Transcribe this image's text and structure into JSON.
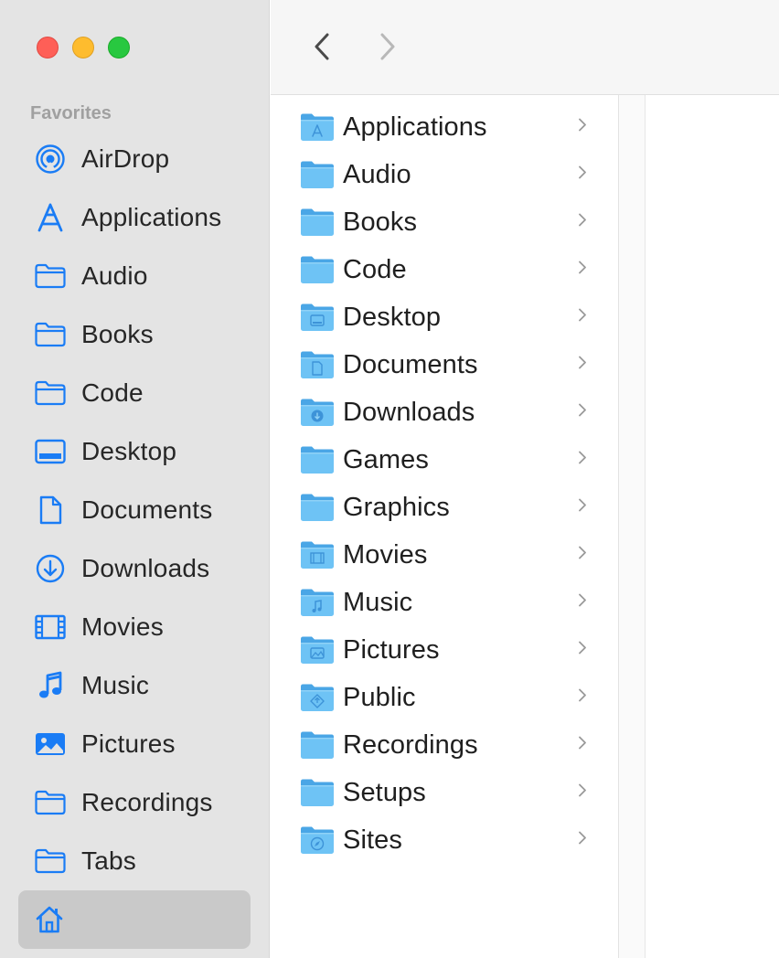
{
  "sidebar": {
    "heading": "Favorites",
    "items": [
      {
        "label": "AirDrop",
        "icon": "airdrop-icon"
      },
      {
        "label": "Applications",
        "icon": "applications-icon"
      },
      {
        "label": "Audio",
        "icon": "folder-icon"
      },
      {
        "label": "Books",
        "icon": "folder-icon"
      },
      {
        "label": "Code",
        "icon": "folder-icon"
      },
      {
        "label": "Desktop",
        "icon": "desktop-icon"
      },
      {
        "label": "Documents",
        "icon": "document-icon"
      },
      {
        "label": "Downloads",
        "icon": "download-icon"
      },
      {
        "label": "Movies",
        "icon": "film-icon"
      },
      {
        "label": "Music",
        "icon": "music-note-icon"
      },
      {
        "label": "Pictures",
        "icon": "photo-icon"
      },
      {
        "label": "Recordings",
        "icon": "folder-icon"
      },
      {
        "label": "Tabs",
        "icon": "folder-icon"
      }
    ],
    "selected": {
      "icon": "home-icon"
    }
  },
  "toolbar": {
    "back_icon": "chevron-left-icon",
    "forward_icon": "chevron-right-icon"
  },
  "column": {
    "items": [
      {
        "name": "Applications",
        "glyph": "applications"
      },
      {
        "name": "Audio",
        "glyph": ""
      },
      {
        "name": "Books",
        "glyph": ""
      },
      {
        "name": "Code",
        "glyph": ""
      },
      {
        "name": "Desktop",
        "glyph": "desktop"
      },
      {
        "name": "Documents",
        "glyph": "document"
      },
      {
        "name": "Downloads",
        "glyph": "download"
      },
      {
        "name": "Games",
        "glyph": ""
      },
      {
        "name": "Graphics",
        "glyph": ""
      },
      {
        "name": "Movies",
        "glyph": "film"
      },
      {
        "name": "Music",
        "glyph": "music"
      },
      {
        "name": "Pictures",
        "glyph": "photo"
      },
      {
        "name": "Public",
        "glyph": "public"
      },
      {
        "name": "Recordings",
        "glyph": ""
      },
      {
        "name": "Setups",
        "glyph": ""
      },
      {
        "name": "Sites",
        "glyph": "compass"
      }
    ]
  },
  "colors": {
    "accent": "#1a7cf5",
    "folder_front": "#6ec3f5",
    "folder_back": "#4aa6e6",
    "sidebar_bg": "#e4e4e4",
    "selection_bg": "#c9c9c9"
  }
}
